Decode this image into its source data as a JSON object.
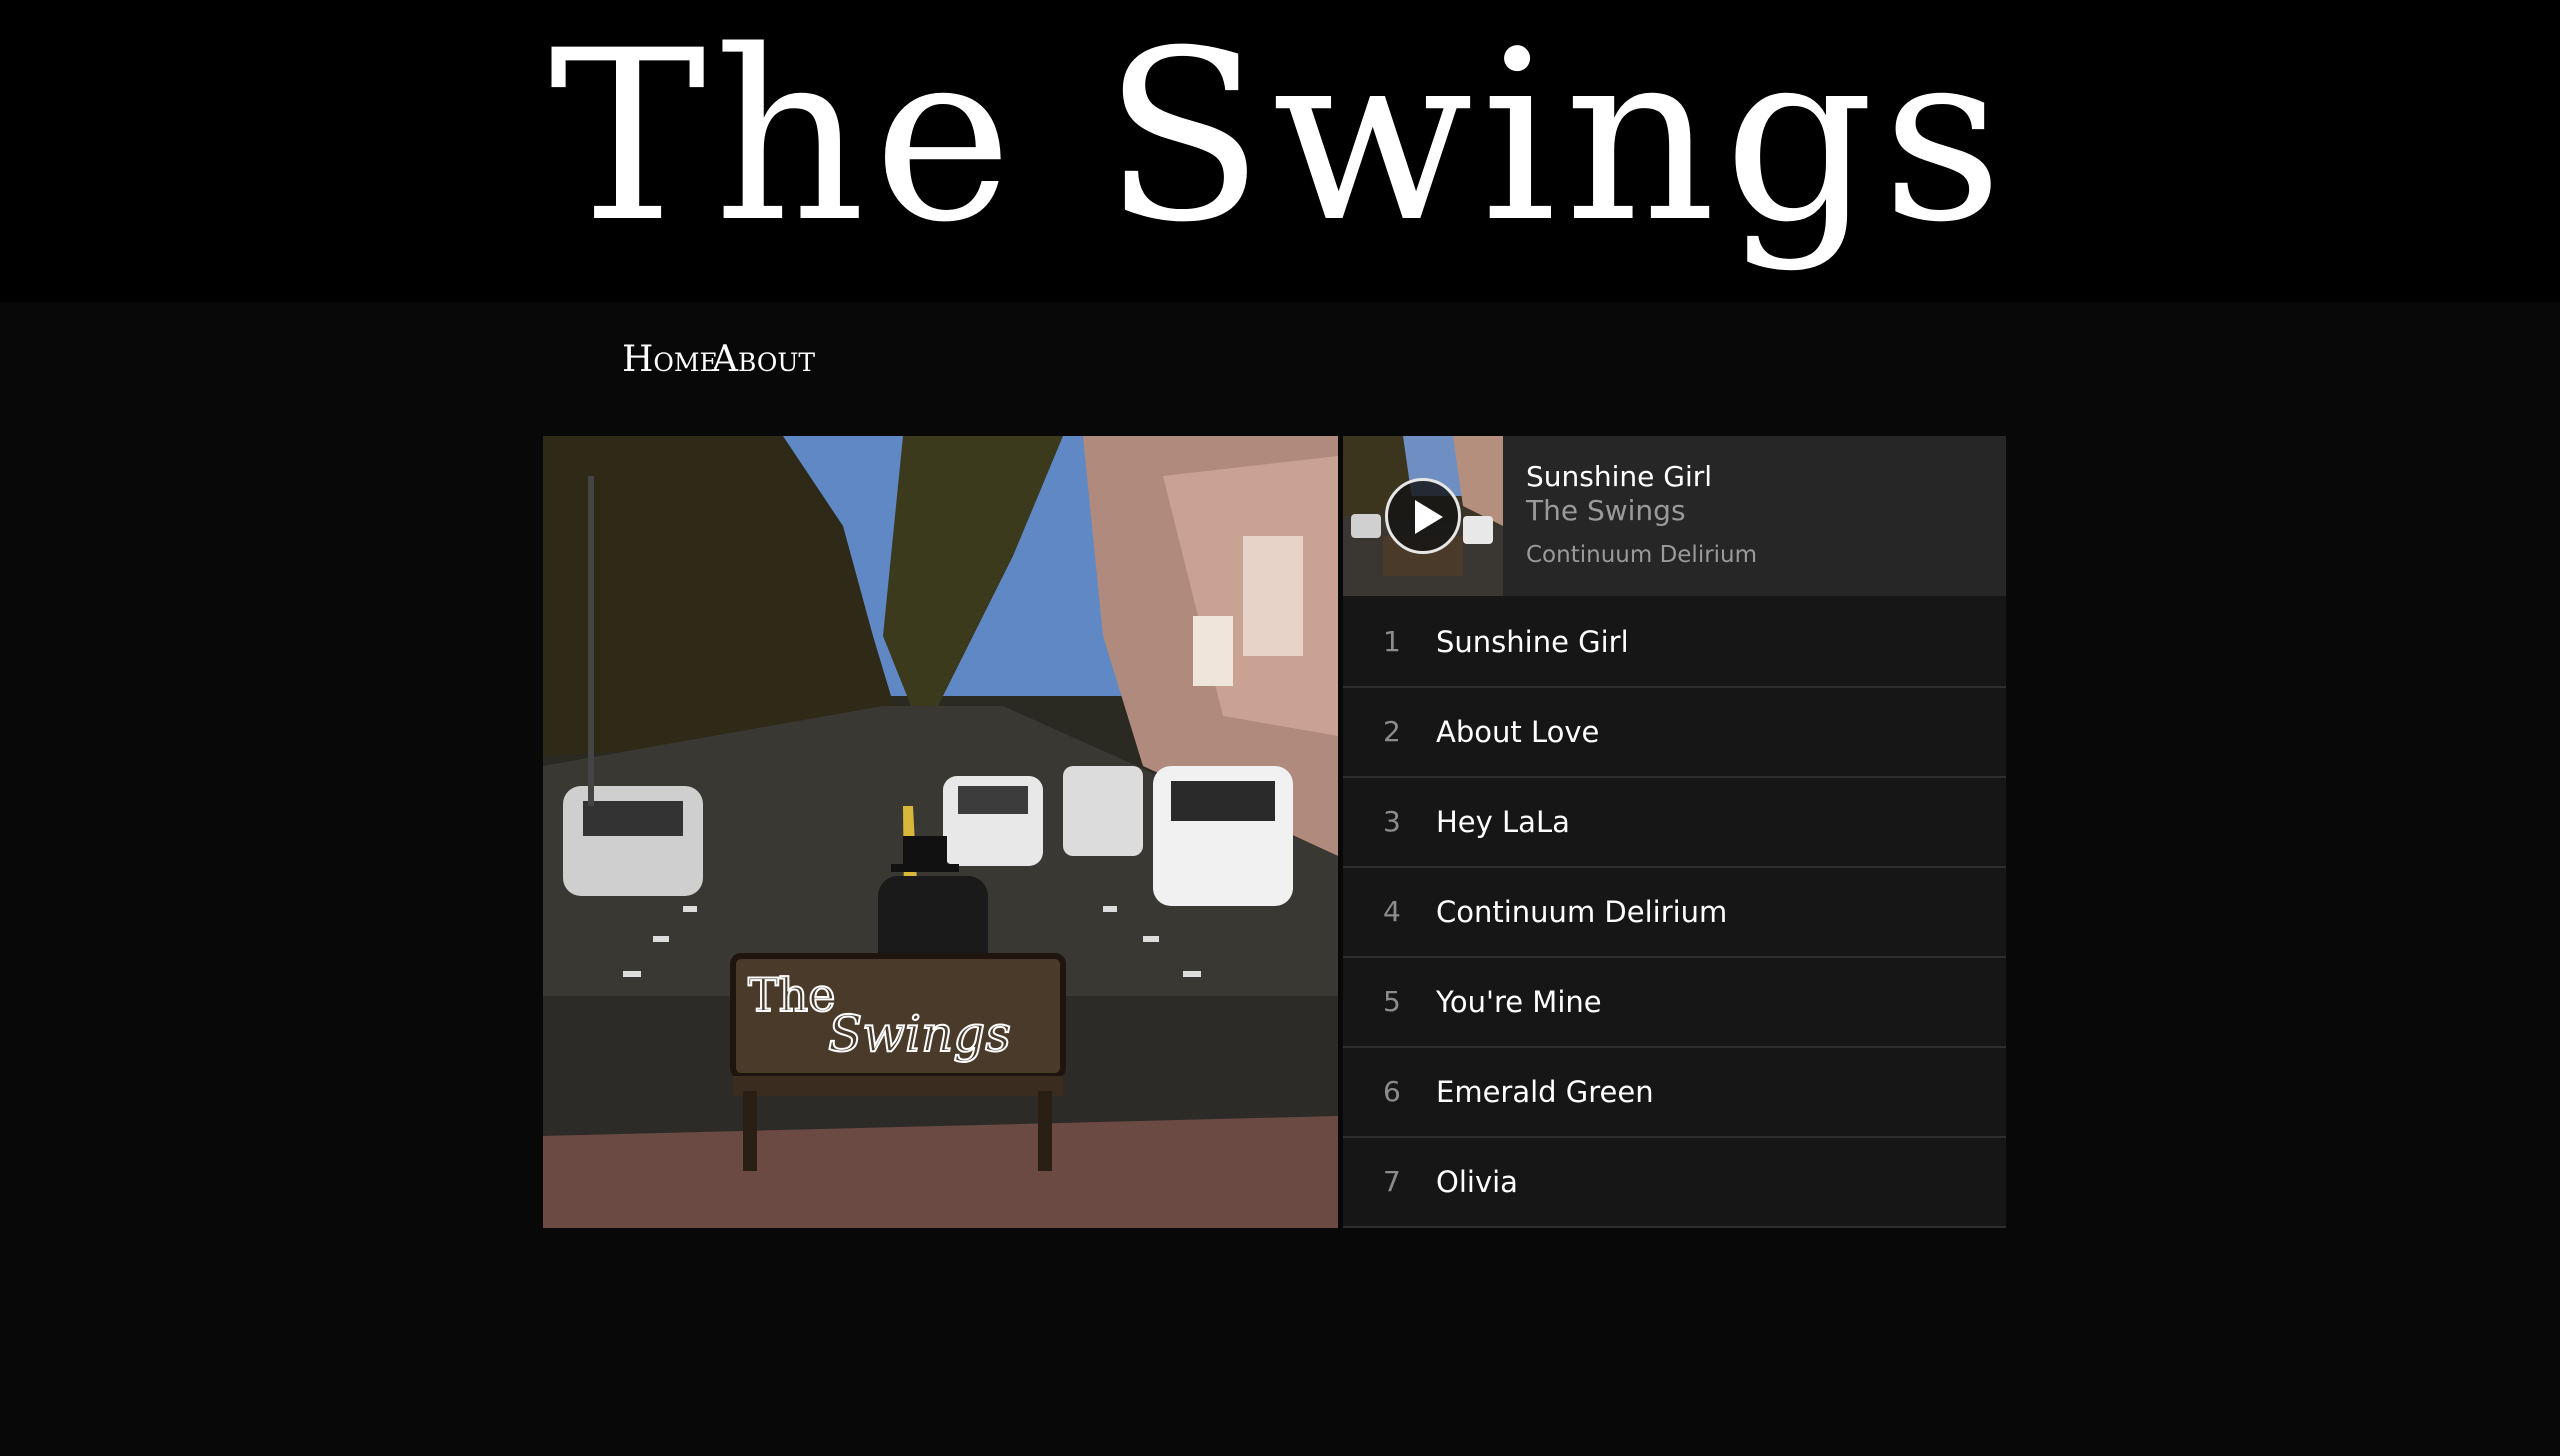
{
  "site": {
    "title": "The Swings"
  },
  "nav": {
    "home_label": "Home",
    "about_label": "About"
  },
  "album": {
    "cover_text_the": "The",
    "cover_text_swings": "Swings"
  },
  "player": {
    "now_playing": {
      "title": "Sunshine Girl",
      "artist": "The Swings",
      "album": "Continuum Delirium"
    },
    "tracks": [
      {
        "num": "1",
        "title": "Sunshine Girl"
      },
      {
        "num": "2",
        "title": "About Love"
      },
      {
        "num": "3",
        "title": "Hey LaLa"
      },
      {
        "num": "4",
        "title": "Continuum Delirium"
      },
      {
        "num": "5",
        "title": "You're Mine"
      },
      {
        "num": "6",
        "title": "Emerald Green"
      },
      {
        "num": "7",
        "title": "Olivia"
      }
    ]
  },
  "icons": {
    "play": "play-icon"
  },
  "colors": {
    "header_bg": "#000000",
    "page_bg": "#080808",
    "player_bg": "#161616",
    "now_playing_bg": "#262626",
    "muted_text": "#9a9a9a"
  }
}
